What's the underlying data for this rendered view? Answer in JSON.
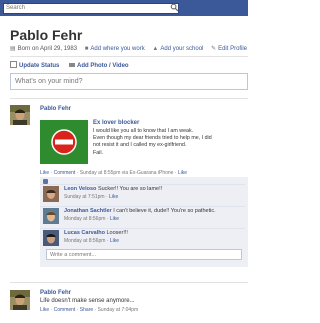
{
  "topbar": {
    "search_placeholder": "Search"
  },
  "profile": {
    "name": "Pablo Fehr",
    "born": "Born on April 29, 1983",
    "add_work": "Add where you work",
    "add_school": "Add your school",
    "edit_profile": "Edit Profile"
  },
  "composer": {
    "update_status": "Update Status",
    "add_photo": "Add Photo / Video",
    "placeholder": "What's on your mind?"
  },
  "post1": {
    "author": "Pablo Fehr",
    "note_title": "Ex lover blocker",
    "note_lines": [
      "I would like you all to know that I am weak.",
      "Even though my dear friends tried to help me, I did",
      "not resist it and I called my ex-girlfriend.",
      "Fail."
    ],
    "meta": {
      "like": "Like",
      "comment": "Comment",
      "time": "Sunday at 8:55pm via Ex-Guarana iPhone",
      "like2": "Like"
    },
    "likes_text": "",
    "comments": [
      {
        "name": "Leon Veloso",
        "text": "Sucker!! You are so lame!!",
        "time": "Sunday at 7:51pm",
        "like": "Like"
      },
      {
        "name": "Jonathan Sachtler",
        "text": "I can't believe it, dude!! You're so pathetic.",
        "time": "Monday at 8:56pm",
        "like": "Like"
      },
      {
        "name": "Lucas Carvalho",
        "text": "Looser!!!",
        "time": "Monday at 8:56pm",
        "like": "Like"
      }
    ],
    "write_placeholder": "Write a comment..."
  },
  "post2": {
    "author": "Pablo Fehr",
    "text": "Life doesn't make sense anymore...",
    "meta": {
      "like": "Like",
      "comment": "Comment",
      "share": "Share",
      "time": "Sunday at 7:04pm"
    }
  },
  "colors": {
    "brand": "#3b5998",
    "comment_bg": "#edeff4",
    "blocker_green": "#2e8b2e",
    "blocker_red": "#d9241b"
  },
  "icons": [
    "search-icon",
    "birthday-icon",
    "briefcase-icon",
    "graduation-cap-icon",
    "pencil-icon",
    "status-icon",
    "camera-icon",
    "like-thumb-icon",
    "no-entry-icon"
  ]
}
